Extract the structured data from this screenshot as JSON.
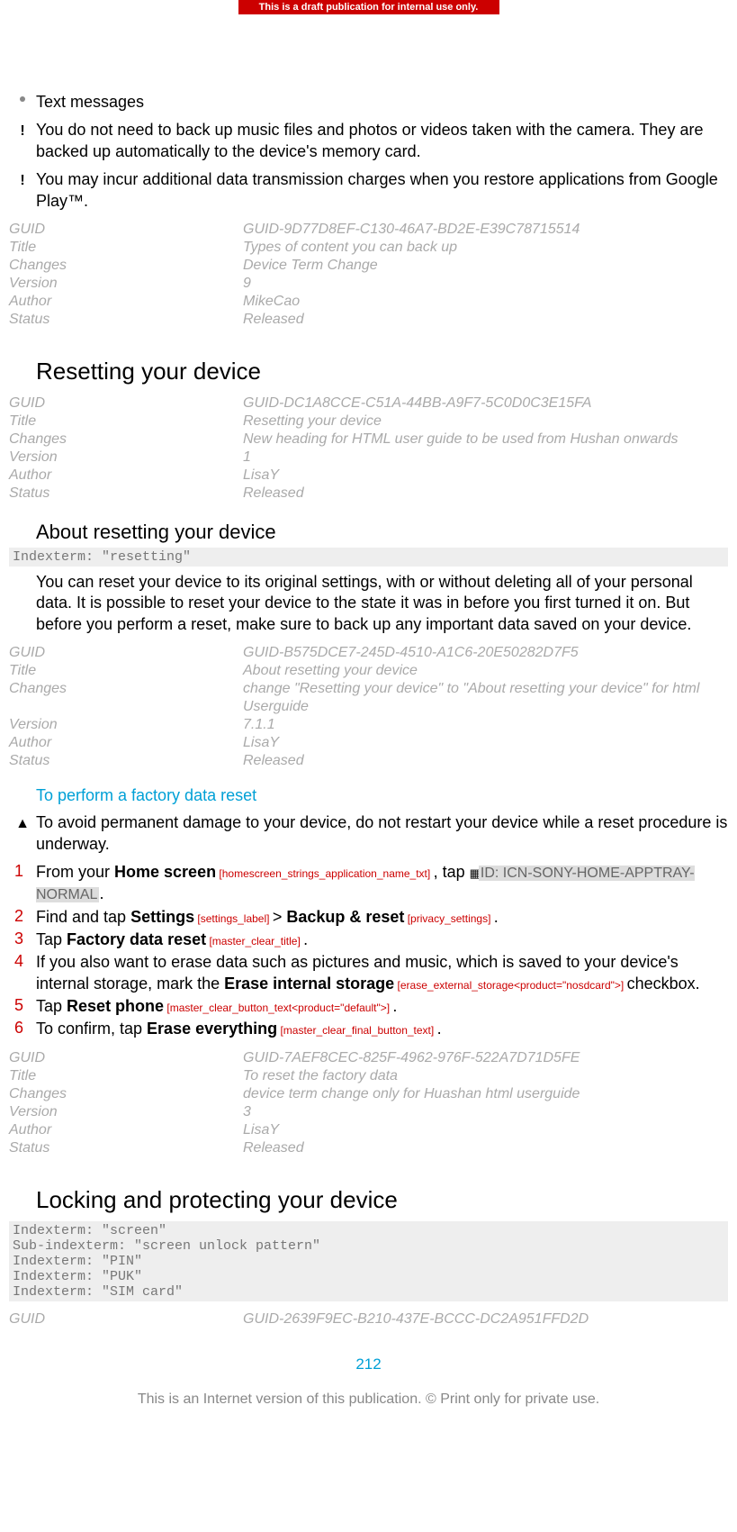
{
  "banner": "This is a draft publication for internal use only.",
  "bullets": {
    "text_messages": "Text messages",
    "note_backup": "You do not need to back up music files and photos or videos taken with the camera. They are backed up automatically to the device's memory card.",
    "note_charges": "You may incur additional data transmission charges when you restore applications from Google Play™."
  },
  "meta1": {
    "guid_k": "GUID",
    "guid_v": "GUID-9D77D8EF-C130-46A7-BD2E-E39C78715514",
    "title_k": "Title",
    "title_v": "Types of content you can back up",
    "changes_k": "Changes",
    "changes_v": "Device Term Change",
    "version_k": "Version",
    "version_v": "9",
    "author_k": "Author",
    "author_v": "MikeCao",
    "status_k": "Status",
    "status_v": "Released"
  },
  "h1_reset": "Resetting your device",
  "meta2": {
    "guid_k": "GUID",
    "guid_v": "GUID-DC1A8CCE-C51A-44BB-A9F7-5C0D0C3E15FA",
    "title_k": "Title",
    "title_v": "Resetting your device",
    "changes_k": "Changes",
    "changes_v": "New heading for HTML user guide to be used from Hushan onwards",
    "version_k": "Version",
    "version_v": "1",
    "author_k": "Author",
    "author_v": "LisaY",
    "status_k": "Status",
    "status_v": "Released"
  },
  "h2_about": "About resetting your device",
  "index_reset": "Indexterm: \"resetting\"",
  "about_body": "You can reset your device to its original settings, with or without deleting all of your personal data. It is possible to reset your device to the state it was in before you first turned it on. But before you perform a reset, make sure to back up any important data saved on your device.",
  "meta3": {
    "guid_k": "GUID",
    "guid_v": "GUID-B575DCE7-245D-4510-A1C6-20E50282D7F5",
    "title_k": "Title",
    "title_v": "About resetting your device",
    "changes_k": "Changes",
    "changes_v": "change \"Resetting your device\" to \"About resetting your device\" for html Userguide",
    "version_k": "Version",
    "version_v": "7.1.1",
    "author_k": "Author",
    "author_v": "LisaY",
    "status_k": "Status",
    "status_v": "Released"
  },
  "h3_factory": "To perform a factory data reset",
  "warn_factory": "To avoid permanent damage to your device, do not restart your device while a reset procedure is underway.",
  "steps": {
    "s1_pre": "From your ",
    "s1_home": "Home screen",
    "s1_tag1": " [homescreen_strings_application_name_txt] ",
    "s1_mid": ", tap ",
    "s1_icnbox": "ID: ICN-SONY-HOME-APPTRAY-NORMAL",
    "s1_end": ".",
    "s2_pre": "Find and tap ",
    "s2_settings": "Settings",
    "s2_tag1": " [settings_label] ",
    "s2_gt": " > ",
    "s2_backup": "Backup & reset",
    "s2_tag2": " [privacy_settings] ",
    "s2_end": ".",
    "s3_pre": "Tap ",
    "s3_fdr": "Factory data reset",
    "s3_tag": " [master_clear_title] ",
    "s3_end": ".",
    "s4_pre": "If you also want to erase data such as pictures and music, which is saved to your device's internal storage, mark the ",
    "s4_erase": "Erase internal storage",
    "s4_tag": " [erase_external_storage<product=\"nosdcard\">] ",
    "s4_end": "checkbox.",
    "s5_pre": "Tap ",
    "s5_reset": "Reset phone",
    "s5_tag": " [master_clear_button_text<product=\"default\">] ",
    "s5_end": ".",
    "s6_pre": "To confirm, tap ",
    "s6_erase": "Erase everything",
    "s6_tag": " [master_clear_final_button_text] ",
    "s6_end": "."
  },
  "meta4": {
    "guid_k": "GUID",
    "guid_v": "GUID-7AEF8CEC-825F-4962-976F-522A7D71D5FE",
    "title_k": "Title",
    "title_v": "To reset the factory data",
    "changes_k": "Changes",
    "changes_v": "device term change only for Huashan html userguide",
    "version_k": "Version",
    "version_v": "3",
    "author_k": "Author",
    "author_v": "LisaY",
    "status_k": "Status",
    "status_v": "Released"
  },
  "h1_lock": "Locking and protecting your device",
  "index_lock": "Indexterm: \"screen\"\nSub-indexterm: \"screen unlock pattern\"\nIndexterm: \"PIN\"\nIndexterm: \"PUK\"\nIndexterm: \"SIM card\"",
  "meta5": {
    "guid_k": "GUID",
    "guid_v": "GUID-2639F9EC-B210-437E-BCCC-DC2A951FFD2D"
  },
  "page_num": "212",
  "footer": "This is an Internet version of this publication. © Print only for private use."
}
